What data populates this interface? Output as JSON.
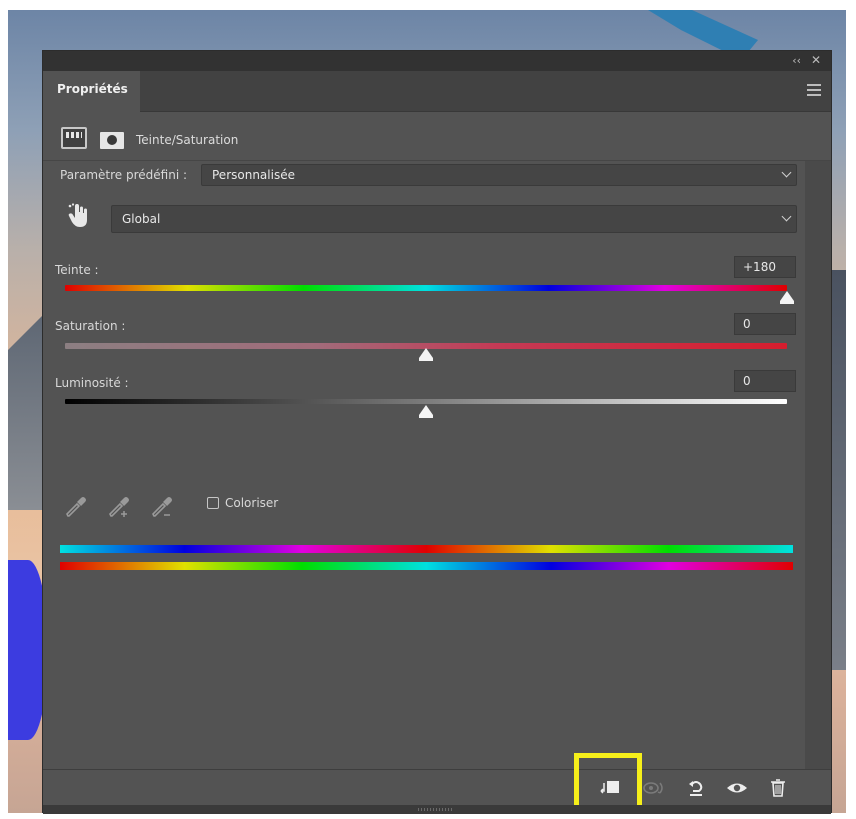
{
  "panel": {
    "tab_label": "Propriétés",
    "adjustment_title": "Teinte/Saturation",
    "collapse_glyph": "‹‹",
    "close_glyph": "✕"
  },
  "preset": {
    "label": "Paramètre prédéfini :",
    "value": "Personnalisée"
  },
  "channel": {
    "value": "Global"
  },
  "sliders": {
    "hue": {
      "label": "Teinte :",
      "value": "+180",
      "level": 1.0
    },
    "saturation": {
      "label": "Saturation :",
      "value": "0",
      "level": 0.5
    },
    "lightness": {
      "label": "Luminosité :",
      "value": "0",
      "level": 0.5
    }
  },
  "colorize": {
    "label": "Coloriser",
    "checked": false
  },
  "icons": {
    "adjustment": "hue-saturation-adjustment-icon",
    "mask": "layer-mask-icon",
    "hand": "targeted-adjustment-hand-icon",
    "eyedroppers": [
      "eyedropper-icon",
      "eyedropper-plus-icon",
      "eyedropper-minus-icon"
    ],
    "footer": [
      "clip-to-layer-icon",
      "view-previous-state-icon",
      "reset-icon",
      "visibility-icon",
      "trash-icon"
    ]
  },
  "colors": {
    "panel_bg": "#535353",
    "highlight": "#f6ef1a"
  }
}
